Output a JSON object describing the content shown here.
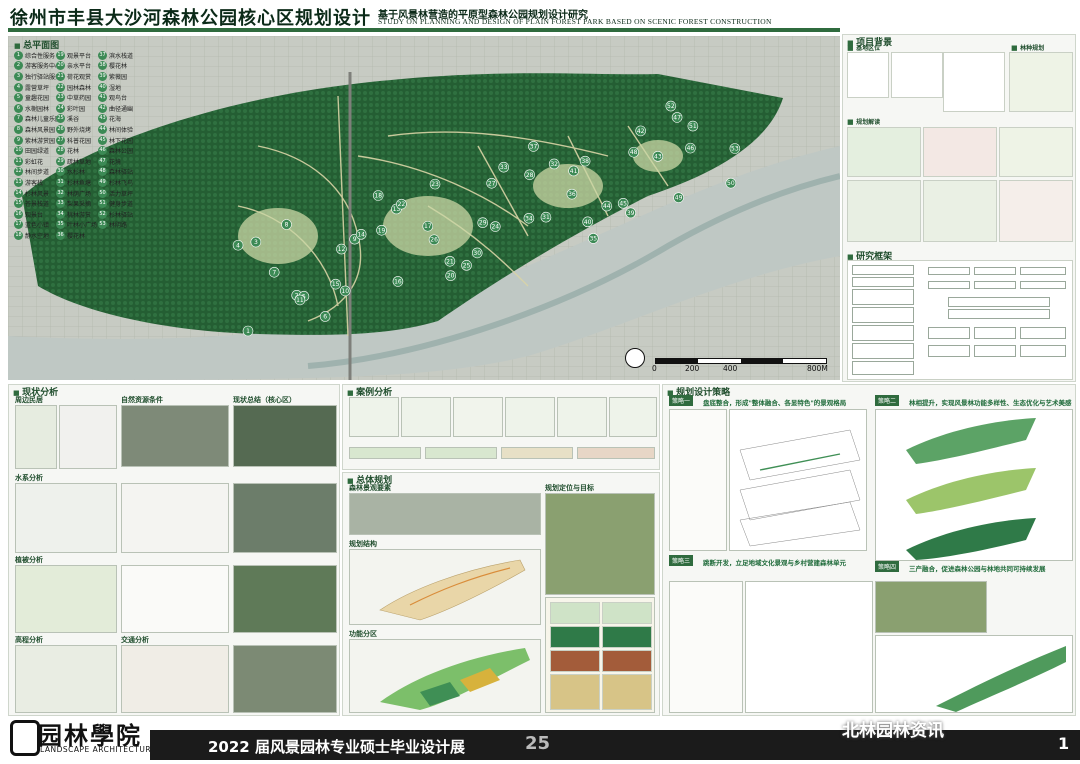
{
  "title": {
    "main": "徐州市丰县大沙河森林公园核心区规划设计",
    "sub_cn": "基于风景林营造的平原型森林公园规划设计研究",
    "sub_en": "STUDY ON PLANNING AND DESIGN OF PLAIN FOREST PARK BASED ON SCENIC FOREST CONSTRUCTION"
  },
  "master_plan": {
    "label": "总平面图",
    "legend": [
      "综合性服务",
      "游客服务中心",
      "独行驿站服务",
      "露营草坪",
      "童趣花园",
      "水榭园林",
      "森林儿童乐园",
      "森林风景园",
      "紫林游赏园",
      "田园绿道",
      "彩虹花",
      "林间步道",
      "游客栈",
      "杉林风景",
      "苍景栈道",
      "观景台",
      "蓝色小镇",
      "静水空地",
      "观景平台",
      "亲水平台",
      "荷花观赏",
      "园林森林",
      "中草药园",
      "彩叶园",
      "溪谷",
      "野外烧烤",
      "科普花园",
      "花林",
      "疏林草地",
      "水杉林",
      "杉林鱼塘",
      "林荫广场",
      "梨果采摘",
      "桃林游赏",
      "叶林小广场",
      "樱花林",
      "滨水栈道",
      "樱花林",
      "紫薇园",
      "湿地",
      "观鸟台",
      "曲径通幽",
      "花海",
      "林间体验",
      "林下花园",
      "森林公园",
      "花境",
      "森林驿站",
      "杉林飞鸟",
      "活力草坪",
      "健身步道",
      "杉林驿站",
      "林阴路"
    ],
    "scale_labels": [
      "0",
      "200",
      "400",
      "800M"
    ],
    "park_numbers": [
      "1",
      "2",
      "3",
      "4",
      "5",
      "6",
      "7",
      "8",
      "9",
      "10",
      "11",
      "12",
      "13",
      "14",
      "15",
      "16",
      "17",
      "18",
      "19",
      "20",
      "21",
      "22",
      "23",
      "24",
      "25",
      "26",
      "27",
      "28",
      "29",
      "30",
      "31",
      "32",
      "33",
      "34",
      "35",
      "36",
      "37",
      "38",
      "39",
      "40",
      "41",
      "42",
      "43",
      "44",
      "45",
      "46",
      "47",
      "48",
      "49",
      "50",
      "51",
      "52",
      "53"
    ]
  },
  "right_column": {
    "background_label": "项目背景",
    "location_label": "基地区位",
    "forest_plan_label": "林种规划",
    "planning_label": "规划解读",
    "framework_label": "研究框架"
  },
  "status_analysis": {
    "label": "现状分析",
    "items": [
      "周边民居",
      "自然资源条件",
      "现状总结（核心区）",
      "水系分析",
      "植被分析",
      "高程分析",
      "交通分析"
    ]
  },
  "case_analysis": {
    "label": "案例分析"
  },
  "overall_plan": {
    "label": "总体规划",
    "items": [
      "森林景观要素",
      "规划定位与目标",
      "规划结构",
      "功能分区"
    ]
  },
  "strategy": {
    "label": "规划设计策略",
    "strategy_1": "策略一",
    "strategy_1_text": "盘底整合，形成\"整体融合、各显特色\"的景观格局",
    "strategy_2": "策略二",
    "strategy_2_text": "林相提升，实现风景林功能多样性、生态优化与艺术美感",
    "strategy_3": "策略三",
    "strategy_3_text": "跳断开发，立足地域文化景观与乡村营建森林单元",
    "strategy_4": "策略四",
    "strategy_4_text": "三产融合，促进森林公园与林地共同可持续发展"
  },
  "footer": {
    "logo_cn": "园林學院",
    "logo_en": "LANDSCAPE ARCHITECTURE SCHOOL",
    "exhibition": "2022 届风景园林专业硕士毕业设计展",
    "number": "25",
    "page": "1",
    "watermark": "北林园林资讯"
  },
  "colors": {
    "forest_dark": "#1f5a30",
    "forest_mid": "#3c7d45",
    "water": "#8ea7a3",
    "accent": "#2f6b3e"
  }
}
